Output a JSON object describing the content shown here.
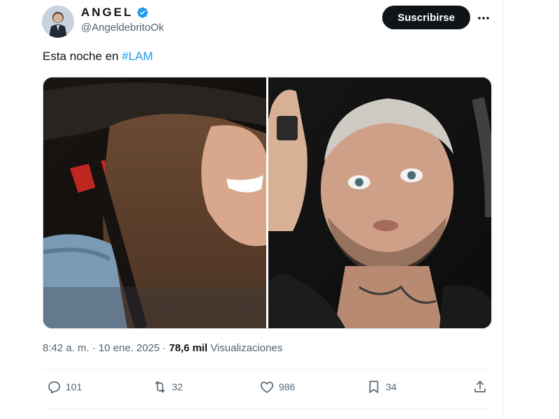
{
  "author": {
    "display_name": "ANGEL",
    "handle": "@AngeldebritoOk",
    "verified": true
  },
  "header": {
    "subscribe_label": "Suscribirse",
    "more_icon": "more-horizontal-icon"
  },
  "tweet": {
    "text_prefix": "Esta noche en ",
    "hashtag": "#LAM"
  },
  "meta": {
    "time": "8:42 a. m.",
    "sep1": " · ",
    "date": "10 ene. 2025",
    "sep2": " · ",
    "views_count": "78,6 mil",
    "views_label": " Visualizaciones"
  },
  "actions": {
    "replies": "101",
    "retweets": "32",
    "likes": "986",
    "bookmarks": "34"
  },
  "colors": {
    "accent": "#1d9bf0",
    "button_bg": "#0f1419",
    "secondary_text": "#536471"
  }
}
